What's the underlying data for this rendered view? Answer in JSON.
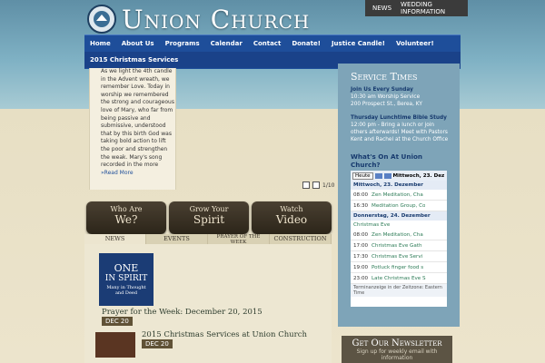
{
  "brand": {
    "name": "Union Church"
  },
  "utility_nav": [
    "NEWS",
    "WEDDING INFORMATION"
  ],
  "nav": {
    "row1": [
      "Home",
      "About Us",
      "Programs",
      "Calendar",
      "Contact",
      "Donate!",
      "Justice Candle!",
      "Volunteer!"
    ],
    "row2": [
      "2015 Christmas Services"
    ]
  },
  "feature": {
    "text": "As we light the 4th candle in the Advent wreath, we remember Love. Today in worship we remembered the strong and courageous love of Mary, who far from being passive and submissive, understood that by this birth God was taking bold action to lift the poor and strengthen the weak. Mary's song recorded in the more",
    "more": "»Read More",
    "slide_counter": "1/10"
  },
  "buttons": [
    {
      "small": "Who Are",
      "large": "We?"
    },
    {
      "small": "Grow Your",
      "large": "Spirit"
    },
    {
      "small": "Watch",
      "large": "Video"
    }
  ],
  "tabs": [
    "NEWS",
    "EVENTS",
    "PRAYER OF THE WEEK",
    "CONSTRUCTION"
  ],
  "news": [
    {
      "title": "Prayer for the Week: December 20, 2015",
      "date": "DEC 20"
    },
    {
      "title": "2015 Christmas Services at Union Church",
      "date": "DEC 20"
    }
  ],
  "news_logo": {
    "line1": "ONE",
    "line2": "IN SPIRIT",
    "line3": "Many in Thought and Deed"
  },
  "service_times": {
    "heading": "Service Times",
    "sunday_title": "Join Us Every Sunday",
    "sunday_time": "10:30 am Worship Service",
    "address": "200 Prospect St., Berea, KY",
    "thursday_title": "Thursday Lunchtime Bible Study",
    "thursday_text": "12:00 pm - Bring a lunch or join others afterwards! Meet with Pastors Kent and Rachel at the Church Office"
  },
  "calendar": {
    "heading": "What's On At Union Church?",
    "today_label": "Heute",
    "date_label": "Mittwoch, 23. Dez",
    "day1": "Mittwoch, 23. Dezember",
    "day1_events": [
      {
        "time": "08:00",
        "title": "Zen Meditation, Cha"
      },
      {
        "time": "16:30",
        "title": "Meditation Group, Co"
      }
    ],
    "day2": "Donnerstag, 24. Dezember",
    "day2_allday": "Christmas Eve",
    "day2_events": [
      {
        "time": "08:00",
        "title": "Zen Meditation, Cha"
      },
      {
        "time": "17:00",
        "title": "Christmas Eve Gath"
      },
      {
        "time": "17:30",
        "title": "Christmas Eve Servi"
      },
      {
        "time": "19:00",
        "title": "Potluck finger food s"
      },
      {
        "time": "23:00",
        "title": "Late Christmas Eve S"
      }
    ],
    "footer": "Terminanzeige in der Zeitzone: Eastern Time"
  },
  "newsletter": {
    "heading": "Get Our Newsletter",
    "text": "Sign up for weekly email with information"
  }
}
